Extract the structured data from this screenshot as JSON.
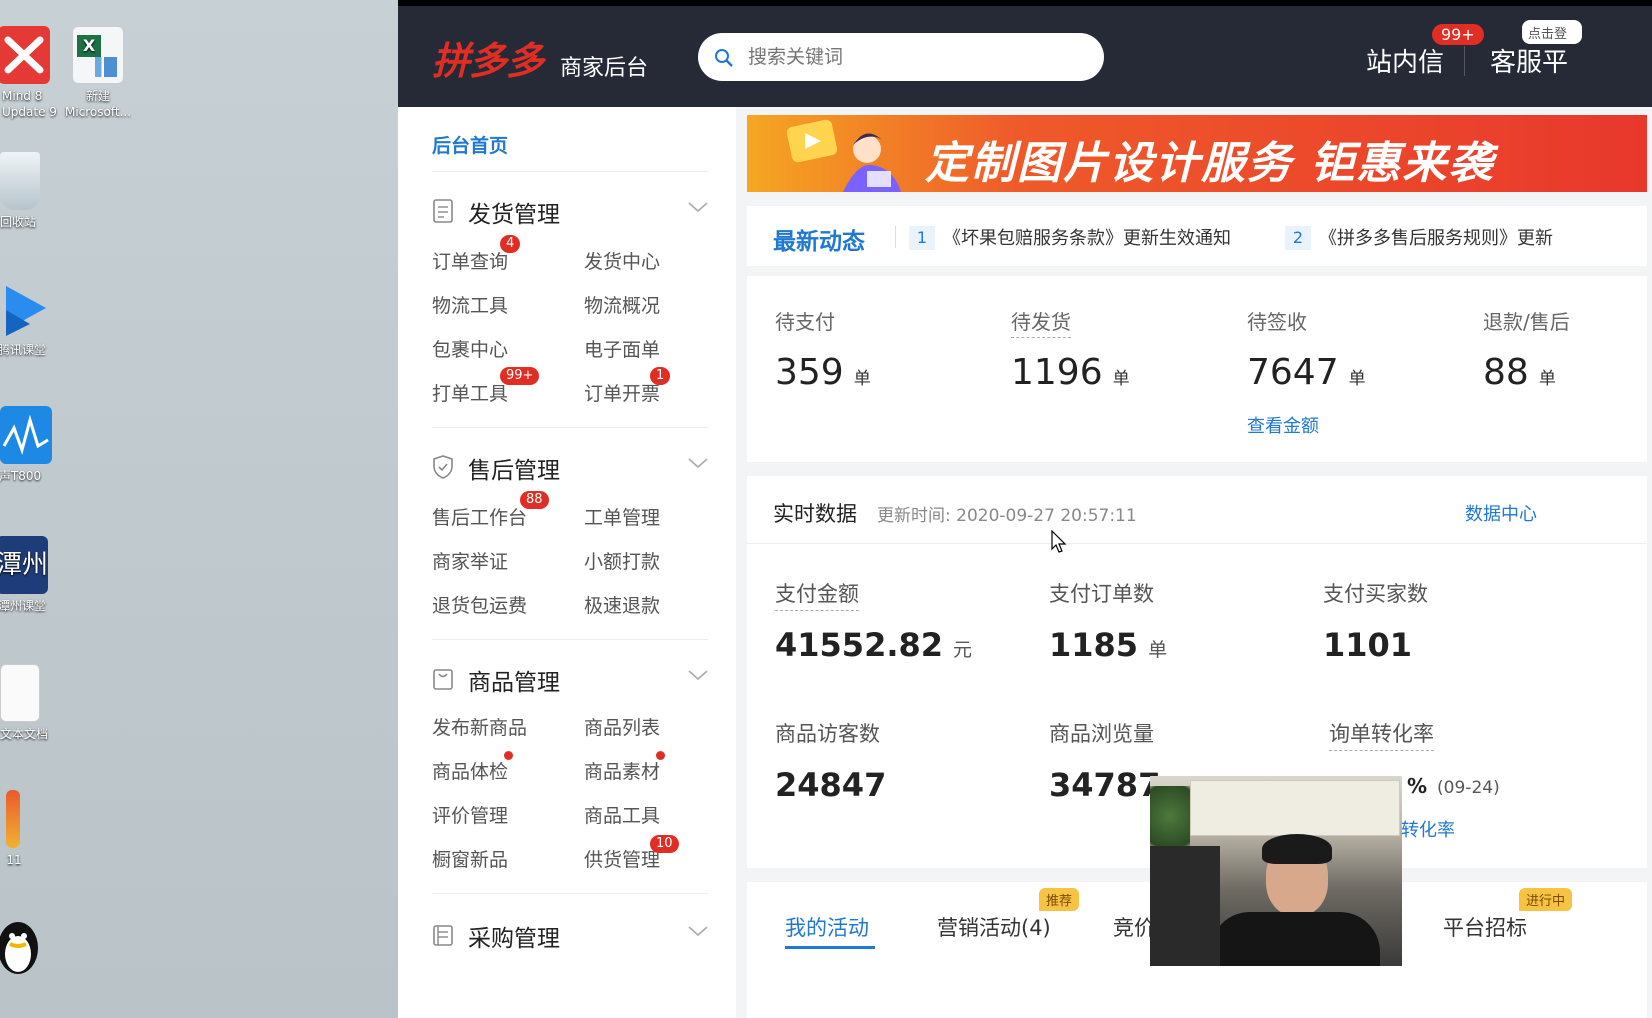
{
  "desktop": {
    "icons": [
      {
        "label": "Mind 8\nUpdate 9",
        "icon": "xmind-icon"
      },
      {
        "label": "新建\nMicrosoft...",
        "icon": "excel-icon"
      },
      {
        "label": "回收站",
        "icon": "recycle-bin-icon"
      },
      {
        "label": "腾讯课堂",
        "icon": "video-play-icon"
      },
      {
        "label": "声T800",
        "icon": "audio-wave-icon"
      },
      {
        "label": "潭州课堂",
        "icon": "classroom-icon"
      },
      {
        "label": "文本文档",
        "icon": "text-document-icon"
      },
      {
        "label": "11",
        "icon": "file-icon"
      },
      {
        "label": "",
        "icon": "qq-penguin-icon"
      }
    ]
  },
  "header": {
    "logo": "拼多多",
    "subtitle": "商家后台",
    "search_placeholder": "搜索关键词",
    "inbox_label": "站内信",
    "inbox_badge": "99+",
    "service_label": "客服平",
    "pill_label": "点击登",
    "colors": {
      "bg": "#252a36",
      "brand": "#e02e24"
    }
  },
  "sidebar": {
    "home": "后台首页",
    "sections": [
      {
        "title": "发货管理",
        "icon": "document-icon",
        "items": [
          {
            "label": "订单查询",
            "badge": "4"
          },
          {
            "label": "发货中心"
          },
          {
            "label": "物流工具"
          },
          {
            "label": "物流概况"
          },
          {
            "label": "包裹中心"
          },
          {
            "label": "电子面单"
          },
          {
            "label": "打单工具",
            "badge": "99+"
          },
          {
            "label": "订单开票",
            "badge": "1"
          }
        ]
      },
      {
        "title": "售后管理",
        "icon": "shield-icon",
        "items": [
          {
            "label": "售后工作台",
            "badge": "88"
          },
          {
            "label": "工单管理"
          },
          {
            "label": "商家举证"
          },
          {
            "label": "小额打款"
          },
          {
            "label": "退货包运费"
          },
          {
            "label": "极速退款"
          }
        ]
      },
      {
        "title": "商品管理",
        "icon": "bag-icon",
        "items": [
          {
            "label": "发布新商品"
          },
          {
            "label": "商品列表"
          },
          {
            "label": "商品体检",
            "dot": true
          },
          {
            "label": "商品素材",
            "dot": true
          },
          {
            "label": "评价管理"
          },
          {
            "label": "商品工具"
          },
          {
            "label": "橱窗新品"
          },
          {
            "label": "供货管理",
            "badge": "10"
          }
        ]
      },
      {
        "title": "采购管理",
        "icon": "purchase-icon",
        "items": []
      }
    ]
  },
  "banner": {
    "text": "定制图片设计服务 钜惠来袭"
  },
  "news": {
    "title": "最新动态",
    "items": [
      {
        "num": "1",
        "text": "《坏果包赔服务条款》更新生效通知"
      },
      {
        "num": "2",
        "text": "《拼多多售后服务规则》更新"
      }
    ]
  },
  "orders": {
    "stats": [
      {
        "label": "待支付",
        "value": "359",
        "unit": "单"
      },
      {
        "label": "待发货",
        "value": "1196",
        "unit": "单"
      },
      {
        "label": "待签收",
        "value": "7647",
        "unit": "单",
        "link": "查看金额"
      },
      {
        "label": "退款/售后",
        "value": "88",
        "unit": "单"
      }
    ]
  },
  "realtime": {
    "title": "实时数据",
    "update_time": "更新时间: 2020-09-27 20:57:11",
    "center_link": "数据中心",
    "metrics": [
      {
        "label": "支付金额",
        "value": "41552.82",
        "unit": "元"
      },
      {
        "label": "支付订单数",
        "value": "1185",
        "unit": "单"
      },
      {
        "label": "支付买家数",
        "value": "1101",
        "unit": ""
      },
      {
        "label": "商品访客数",
        "value": "24847",
        "unit": ""
      },
      {
        "label": "商品浏览量",
        "value": "34787",
        "unit": ""
      },
      {
        "label": "询单转化率",
        "value": "%",
        "unit": "(09-24)",
        "link": "转化率"
      }
    ]
  },
  "activities": {
    "tabs": [
      {
        "label": "我的活动",
        "active": true
      },
      {
        "label": "营销活动(4)",
        "tag": "推荐"
      },
      {
        "label": "竞价"
      },
      {
        "label": "平台招标",
        "tag": "进行中"
      }
    ]
  }
}
